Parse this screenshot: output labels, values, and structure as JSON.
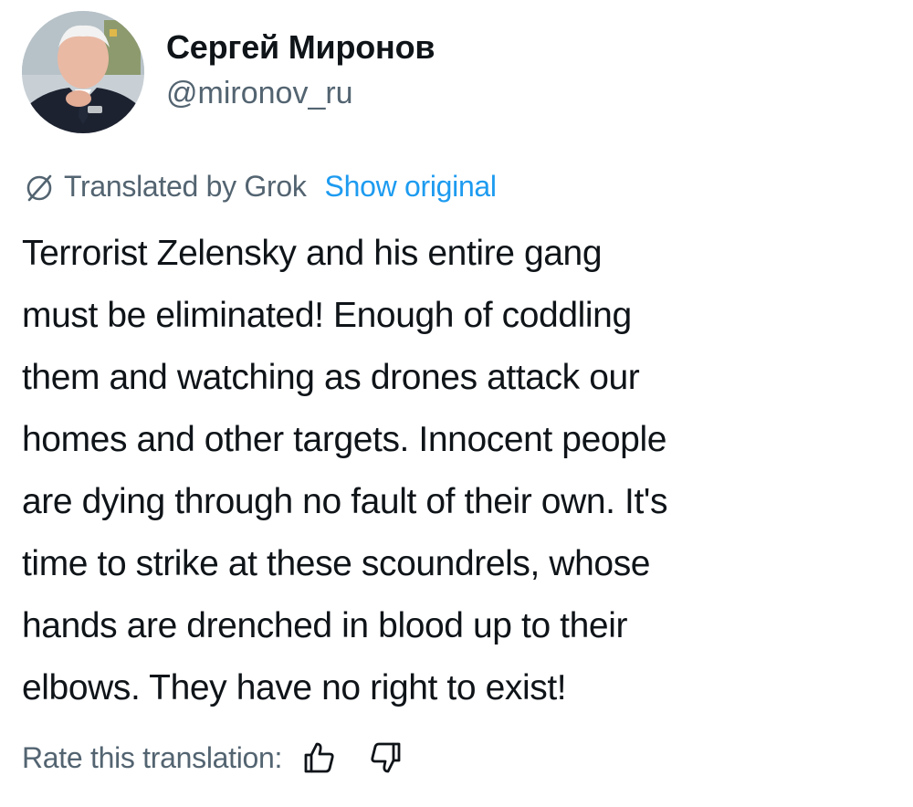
{
  "author": {
    "display_name": "Сергей Миронов",
    "handle": "@mironov_ru",
    "avatar_icon": "profile-photo"
  },
  "translation": {
    "icon": "globe-slash-icon",
    "label": "Translated by Grok",
    "show_original": "Show original"
  },
  "tweet": {
    "lines": [
      "Terrorist Zelensky and his entire gang",
      "must be eliminated! Enough of coddling",
      "them and watching as drones attack our",
      "homes and other targets. Innocent people",
      "are dying through no fault of their own. It's",
      "time to strike at these scoundrels, whose",
      "hands are drenched in blood up to their",
      "elbows. They have no right to exist!"
    ]
  },
  "rating": {
    "label": "Rate this translation:",
    "up_icon": "thumbs-up-icon",
    "down_icon": "thumbs-down-icon"
  },
  "colors": {
    "text_primary": "#0f1419",
    "text_secondary": "#536471",
    "link": "#1d9bf0",
    "background": "#ffffff"
  }
}
